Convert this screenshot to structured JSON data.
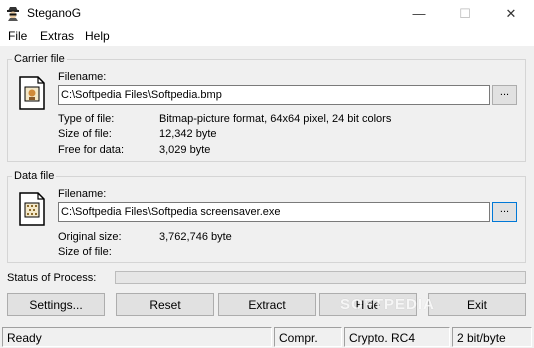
{
  "window": {
    "title": "SteganoG",
    "min_glyph": "—",
    "max_glyph": "☐",
    "close_glyph": "✕"
  },
  "menu": [
    "File",
    "Extras",
    "Help"
  ],
  "carrier": {
    "group_label": "Carrier file",
    "filename_label": "Filename:",
    "filename_value": "C:\\Softpedia Files\\Softpedia.bmp",
    "browse_label": "...",
    "rows": [
      {
        "label": "Type of file:",
        "value": "Bitmap-picture format, 64x64 pixel, 24 bit colors"
      },
      {
        "label": "Size of file:",
        "value": "12,342 byte"
      },
      {
        "label": "Free for data:",
        "value": "3,029 byte"
      }
    ]
  },
  "data_file": {
    "group_label": "Data file",
    "filename_label": "Filename:",
    "filename_value": "C:\\Softpedia Files\\Softpedia screensaver.exe",
    "browse_label": "...",
    "rows": [
      {
        "label": "Original size:",
        "value": "3,762,746 byte"
      },
      {
        "label": "Size of file:",
        "value": ""
      }
    ]
  },
  "process": {
    "label": "Status of Process:",
    "progress": 0
  },
  "buttons": {
    "settings": "Settings...",
    "reset": "Reset",
    "extract": "Extract",
    "hide": "Hide",
    "exit": "Exit"
  },
  "statusbar": {
    "state": "Ready",
    "compression": "Compr.",
    "crypto": "Crypto. RC4",
    "bits": "2 bit/byte"
  },
  "watermark": "SOFTPEDIA",
  "icons": {
    "app": "spy-icon",
    "carrier": "picture-file-icon",
    "data": "data-file-icon"
  }
}
